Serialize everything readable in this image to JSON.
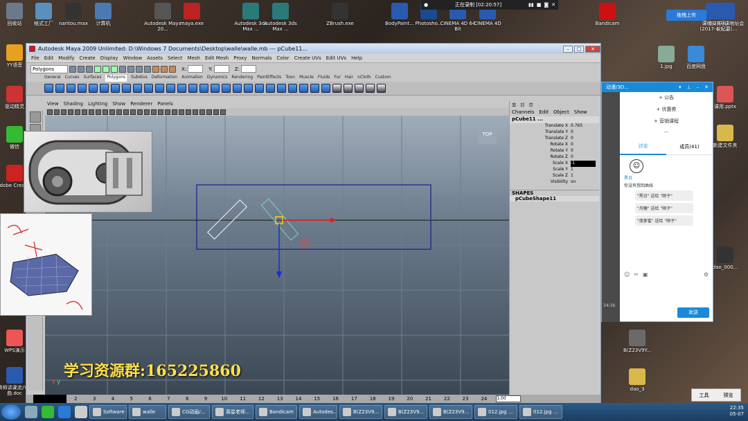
{
  "desktop": {
    "icons_left": [
      {
        "label": "回收站",
        "color": "#6a7a8a"
      },
      {
        "label": "格式工厂",
        "color": "#5a90c0"
      },
      {
        "label": "nantou.max",
        "color": "#333"
      },
      {
        "label": "计算机",
        "color": "#4a7ab0"
      }
    ],
    "icons_top": [
      {
        "label": "Autodesk Maya 20...",
        "color": "#555"
      },
      {
        "label": "maya.exe",
        "color": "#b22"
      },
      {
        "label": "Autodesk 3ds Max ...",
        "color": "#2a7a7a"
      },
      {
        "label": "Autodesk 3ds Max ...",
        "color": "#2a7a7a"
      },
      {
        "label": "ZBrush.exe",
        "color": "#333"
      },
      {
        "label": "BodyPaint...",
        "color": "#2a5ab0"
      },
      {
        "label": "Photosho...",
        "color": "#1a4a90"
      },
      {
        "label": "CINEMA 4D 64 Bit",
        "color": "#2a5ab0"
      },
      {
        "label": "CINEMA 4D",
        "color": "#2a5ab0"
      },
      {
        "label": "Bandicam",
        "color": "#c11"
      }
    ],
    "icons_side": [
      {
        "label": "YY语音",
        "color": "#e8a020"
      },
      {
        "label": "驱动精灵",
        "color": "#c33"
      },
      {
        "label": "微信",
        "color": "#3b3"
      },
      {
        "label": "Adobe Creati...",
        "color": "#c22"
      },
      {
        "label": "WPS演示",
        "color": "#e55"
      },
      {
        "label": "讲师讲课流六步曲.doc",
        "color": "#2a5ab0"
      }
    ],
    "icons_right": [
      {
        "label": "1.jpg",
        "color": "#8a9"
      },
      {
        "label": "百度网盘",
        "color": "#3a8ad8"
      },
      {
        "label": "课程安排表(2017-4-1...",
        "color": "#2a5ab0"
      },
      {
        "label": "6.28开课地址会议纪要(...",
        "color": "#2a5ab0"
      },
      {
        "label": "课用.pptx",
        "color": "#d55"
      },
      {
        "label": "新建文件夹",
        "color": "#d9b84a"
      },
      {
        "label": "dao_000...",
        "color": "#333"
      },
      {
        "label": "B(Z23V9Y...",
        "color": "#6a6a6a"
      },
      {
        "label": "dao_3",
        "color": "#d9b84a"
      }
    ],
    "upload_label": "拖拽上传"
  },
  "recorder": {
    "status": "正在录制 [02:20:57]"
  },
  "maya": {
    "title": "Autodesk Maya 2009 Unlimited: D:\\Windows 7 Documents\\Desktop\\walle\\walle.mb  ---  pCube11...",
    "menu": [
      "File",
      "Edit",
      "Modify",
      "Create",
      "Display",
      "Window",
      "Assets",
      "Select",
      "Mesh",
      "Edit Mesh",
      "Proxy",
      "Normals",
      "Color",
      "Create UVs",
      "Edit UVs",
      "Help"
    ],
    "mode": "Polygons",
    "coord_labels": [
      "X:",
      "Y:",
      "Z:"
    ],
    "shelf_tabs": [
      "General",
      "Curves",
      "Surfaces",
      "Polygons",
      "Subdivs",
      "Deformation",
      "Animation",
      "Dynamics",
      "Rendering",
      "PaintEffects",
      "Toon",
      "Muscle",
      "Fluids",
      "Fur",
      "Hair",
      "nCloth",
      "Custom"
    ],
    "viewport_menu": [
      "View",
      "Shading",
      "Lighting",
      "Show",
      "Renderer",
      "Panels"
    ],
    "view_label": "TOP",
    "axis_x": "x",
    "axis_y": "y",
    "channel_menu": [
      "Channels",
      "Edit",
      "Object",
      "Show"
    ],
    "object": "pCube11 ...",
    "attributes": [
      {
        "name": "Translate X",
        "value": "0.765"
      },
      {
        "name": "Translate Y",
        "value": "0"
      },
      {
        "name": "Translate Z",
        "value": "0"
      },
      {
        "name": "Rotate X",
        "value": "0"
      },
      {
        "name": "Rotate Y",
        "value": "0"
      },
      {
        "name": "Rotate Z",
        "value": "0"
      },
      {
        "name": "Scale X",
        "value": "-1"
      },
      {
        "name": "Scale Y",
        "value": "1"
      },
      {
        "name": "Scale Z",
        "value": "1"
      },
      {
        "name": "Visibility",
        "value": "on"
      }
    ],
    "shapes_label": "SHAPES",
    "shape_name": "pCubeShape11",
    "timeline_ticks": [
      "2",
      "3",
      "4",
      "5",
      "6",
      "7",
      "8",
      "9",
      "10",
      "11",
      "12",
      "13",
      "14",
      "15",
      "16",
      "17",
      "18",
      "19",
      "20",
      "21",
      "22",
      "23",
      "24"
    ],
    "frame": "1.00"
  },
  "promo": "学习资源群:165225860",
  "qq": {
    "title": "动漫/3D...",
    "links": [
      "公告",
      "优惠券",
      "营销课程"
    ],
    "tabs": [
      "讨论",
      "成员(41)"
    ],
    "user": "黑日",
    "message": "你没有想到曲线",
    "gifts": [
      "\"黑日\" 送给 \"顺子\"",
      "\"月糖\" 送给 \"顺子\"",
      "\"菠萝蜜\" 送给 \"顺子\""
    ],
    "send": "发送",
    "side_time": "34:36"
  },
  "tools": {
    "a": "工具",
    "b": "预览"
  },
  "taskbar": {
    "items": [
      "Software",
      "walle",
      "CG动画/...",
      "周星老师...",
      "Bandicam",
      "Autodes...",
      "B(Z23V9...",
      "B(Z23V9...",
      "B(Z23V9...",
      "012.jpg ...",
      "012.jpg ..."
    ],
    "time": "22:35",
    "date": "05-07"
  }
}
